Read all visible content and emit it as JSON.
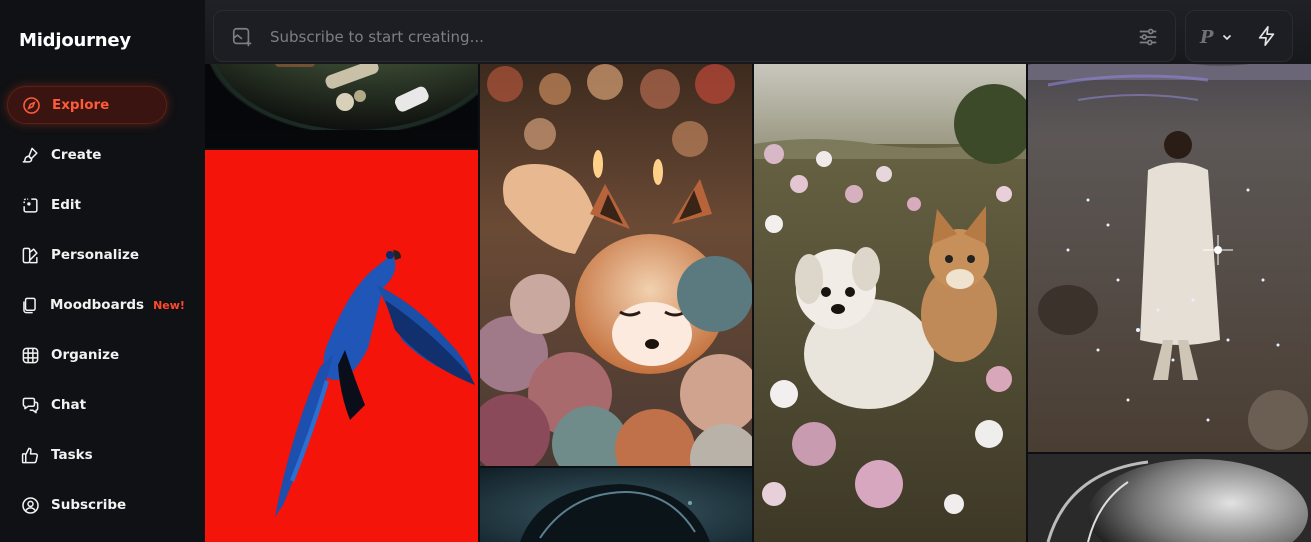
{
  "app": {
    "brand": "Midjourney"
  },
  "sidebar": {
    "items": [
      {
        "label": "Explore",
        "icon": "compass-icon",
        "active": true
      },
      {
        "label": "Create",
        "icon": "brush-icon"
      },
      {
        "label": "Edit",
        "icon": "edit-icon"
      },
      {
        "label": "Personalize",
        "icon": "palette-icon"
      },
      {
        "label": "Moodboards",
        "icon": "moodboard-icon",
        "badge": "New!"
      },
      {
        "label": "Organize",
        "icon": "grid-icon"
      },
      {
        "label": "Chat",
        "icon": "chat-icon"
      },
      {
        "label": "Tasks",
        "icon": "thumbs-up-icon"
      },
      {
        "label": "Subscribe",
        "icon": "user-icon"
      }
    ]
  },
  "search": {
    "placeholder": "Subscribe to start creating..."
  },
  "personalize_toggle": {
    "label": "P"
  },
  "colors": {
    "accent": "#ff5a3a",
    "sidebar_bg": "#101114",
    "bar_bg": "#1d1e23"
  },
  "gallery": {
    "tiles": [
      {
        "name": "tile-skateboard-fisheye"
      },
      {
        "name": "tile-blue-parrot-red"
      },
      {
        "name": "tile-fox-pompoms"
      },
      {
        "name": "tile-dark-portrait"
      },
      {
        "name": "tile-puppy-kitten-flowers"
      },
      {
        "name": "tile-figure-sparkles"
      },
      {
        "name": "tile-monochrome-sphere"
      }
    ]
  }
}
